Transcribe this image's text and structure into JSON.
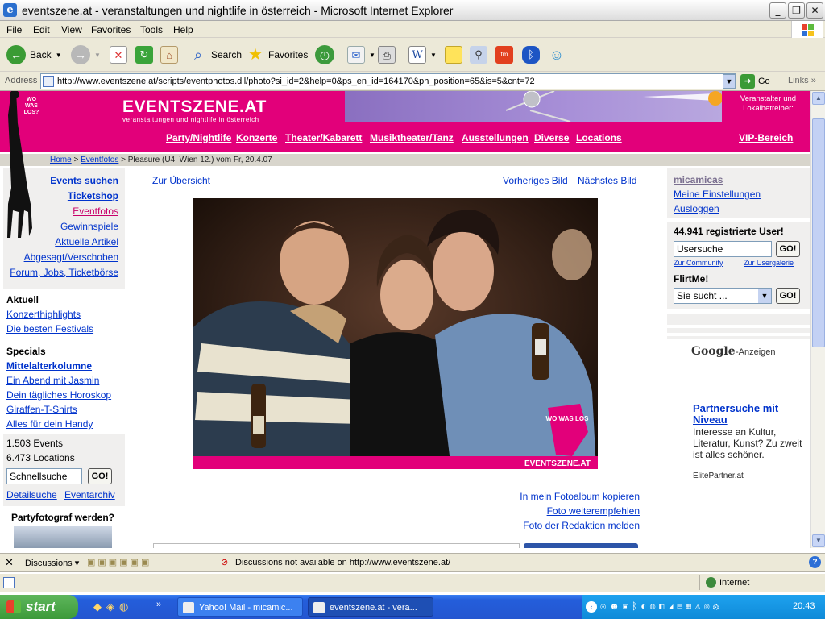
{
  "window": {
    "title": "eventszene.at - veranstaltungen und nightlife in österreich - Microsoft Internet Explorer"
  },
  "menu": [
    "File",
    "Edit",
    "View",
    "Favorites",
    "Tools",
    "Help"
  ],
  "toolbar": {
    "back": "Back",
    "search": "Search",
    "favorites": "Favorites"
  },
  "address": {
    "label": "Address",
    "url": "http://www.eventszene.at/scripts/eventphotos.dll/photo?si_id=2&help=0&ps_en_id=164170&ph_position=65&is=5&cnt=72",
    "go": "Go",
    "links": "Links"
  },
  "site": {
    "logo": "WO WAS LOS?",
    "brand": "EVENTSZENE.AT",
    "tagline": "veranstaltungen und nightlife in österreich",
    "operators": "Veranstalter und Lokalbetreiber:",
    "nav": [
      "Party/Nightlife",
      "Konzerte",
      "Theater/Kabarett",
      "Musiktheater/Tanz",
      "Ausstellungen",
      "Diverse",
      "Locations"
    ],
    "vip": "VIP-Bereich",
    "crumb_home": "Home",
    "crumb_sep": ">",
    "crumb_fotos": "Eventfotos",
    "crumb_rest": "> Pleasure (U4, Wien 12.) vom Fr, 20.4.07"
  },
  "left": {
    "main_links": [
      "Events suchen",
      "Ticketshop",
      "Eventfotos",
      "Gewinnspiele",
      "Aktuelle Artikel",
      "Abgesagt/Verschoben",
      "Forum, Jobs, Ticketbörse"
    ],
    "aktuell_heading": "Aktuell",
    "aktuell_links": [
      "Konzerthighlights",
      "Die besten Festivals"
    ],
    "specials_heading": "Specials",
    "specials_links": [
      "Mittelalterkolumne",
      "Ein Abend mit Jasmin",
      "Dein tägliches Horoskop",
      "Giraffen-T-Shirts",
      "Alles für dein Handy"
    ],
    "events_count": "1.503 Events",
    "locations_count": "6.473 Locations",
    "quicksearch": "Schnellsuche",
    "go": "GO!",
    "detail": "Detailsuche",
    "archive": "Eventarchiv",
    "fotograf": "Partyfotograf werden?"
  },
  "content": {
    "overview": "Zur Übersicht",
    "prev": "Vorheriges Bild",
    "next": "Nächstes Bild",
    "watermark": "EVENTSZENE.AT",
    "photo_logo": "WO WAS LOS",
    "actions": [
      "In mein Fotoalbum kopieren",
      "Foto weiterempfehlen",
      "Foto der Redaktion melden"
    ]
  },
  "right": {
    "user": "micamicas",
    "settings": "Meine Einstellungen",
    "logout": "Ausloggen",
    "registered": "44.941 registrierte User!",
    "usersearch": "Usersuche",
    "go": "GO!",
    "community": "Zur Community",
    "gallery": "Zur Usergalerie",
    "flirt": "FlirtMe!",
    "flirt_select": "Sie sucht ...",
    "google_brand": "Google",
    "google_suffix": "-Anzeigen",
    "ad_title": "Partnersuche mit Niveau",
    "ad_text": "Interesse an Kultur, Literatur, Kunst? Zu zweit ist alles schöner.",
    "ad_url": "ElitePartner.at"
  },
  "discussions": {
    "label": "Discussions",
    "msg": "Discussions not available on http://www.eventszene.at/"
  },
  "status": {
    "zone": "Internet"
  },
  "taskbar": {
    "start": "start",
    "tasks": [
      "Yahoo! Mail - micamic...",
      "eventszene.at - vera..."
    ],
    "time": "20:43"
  }
}
